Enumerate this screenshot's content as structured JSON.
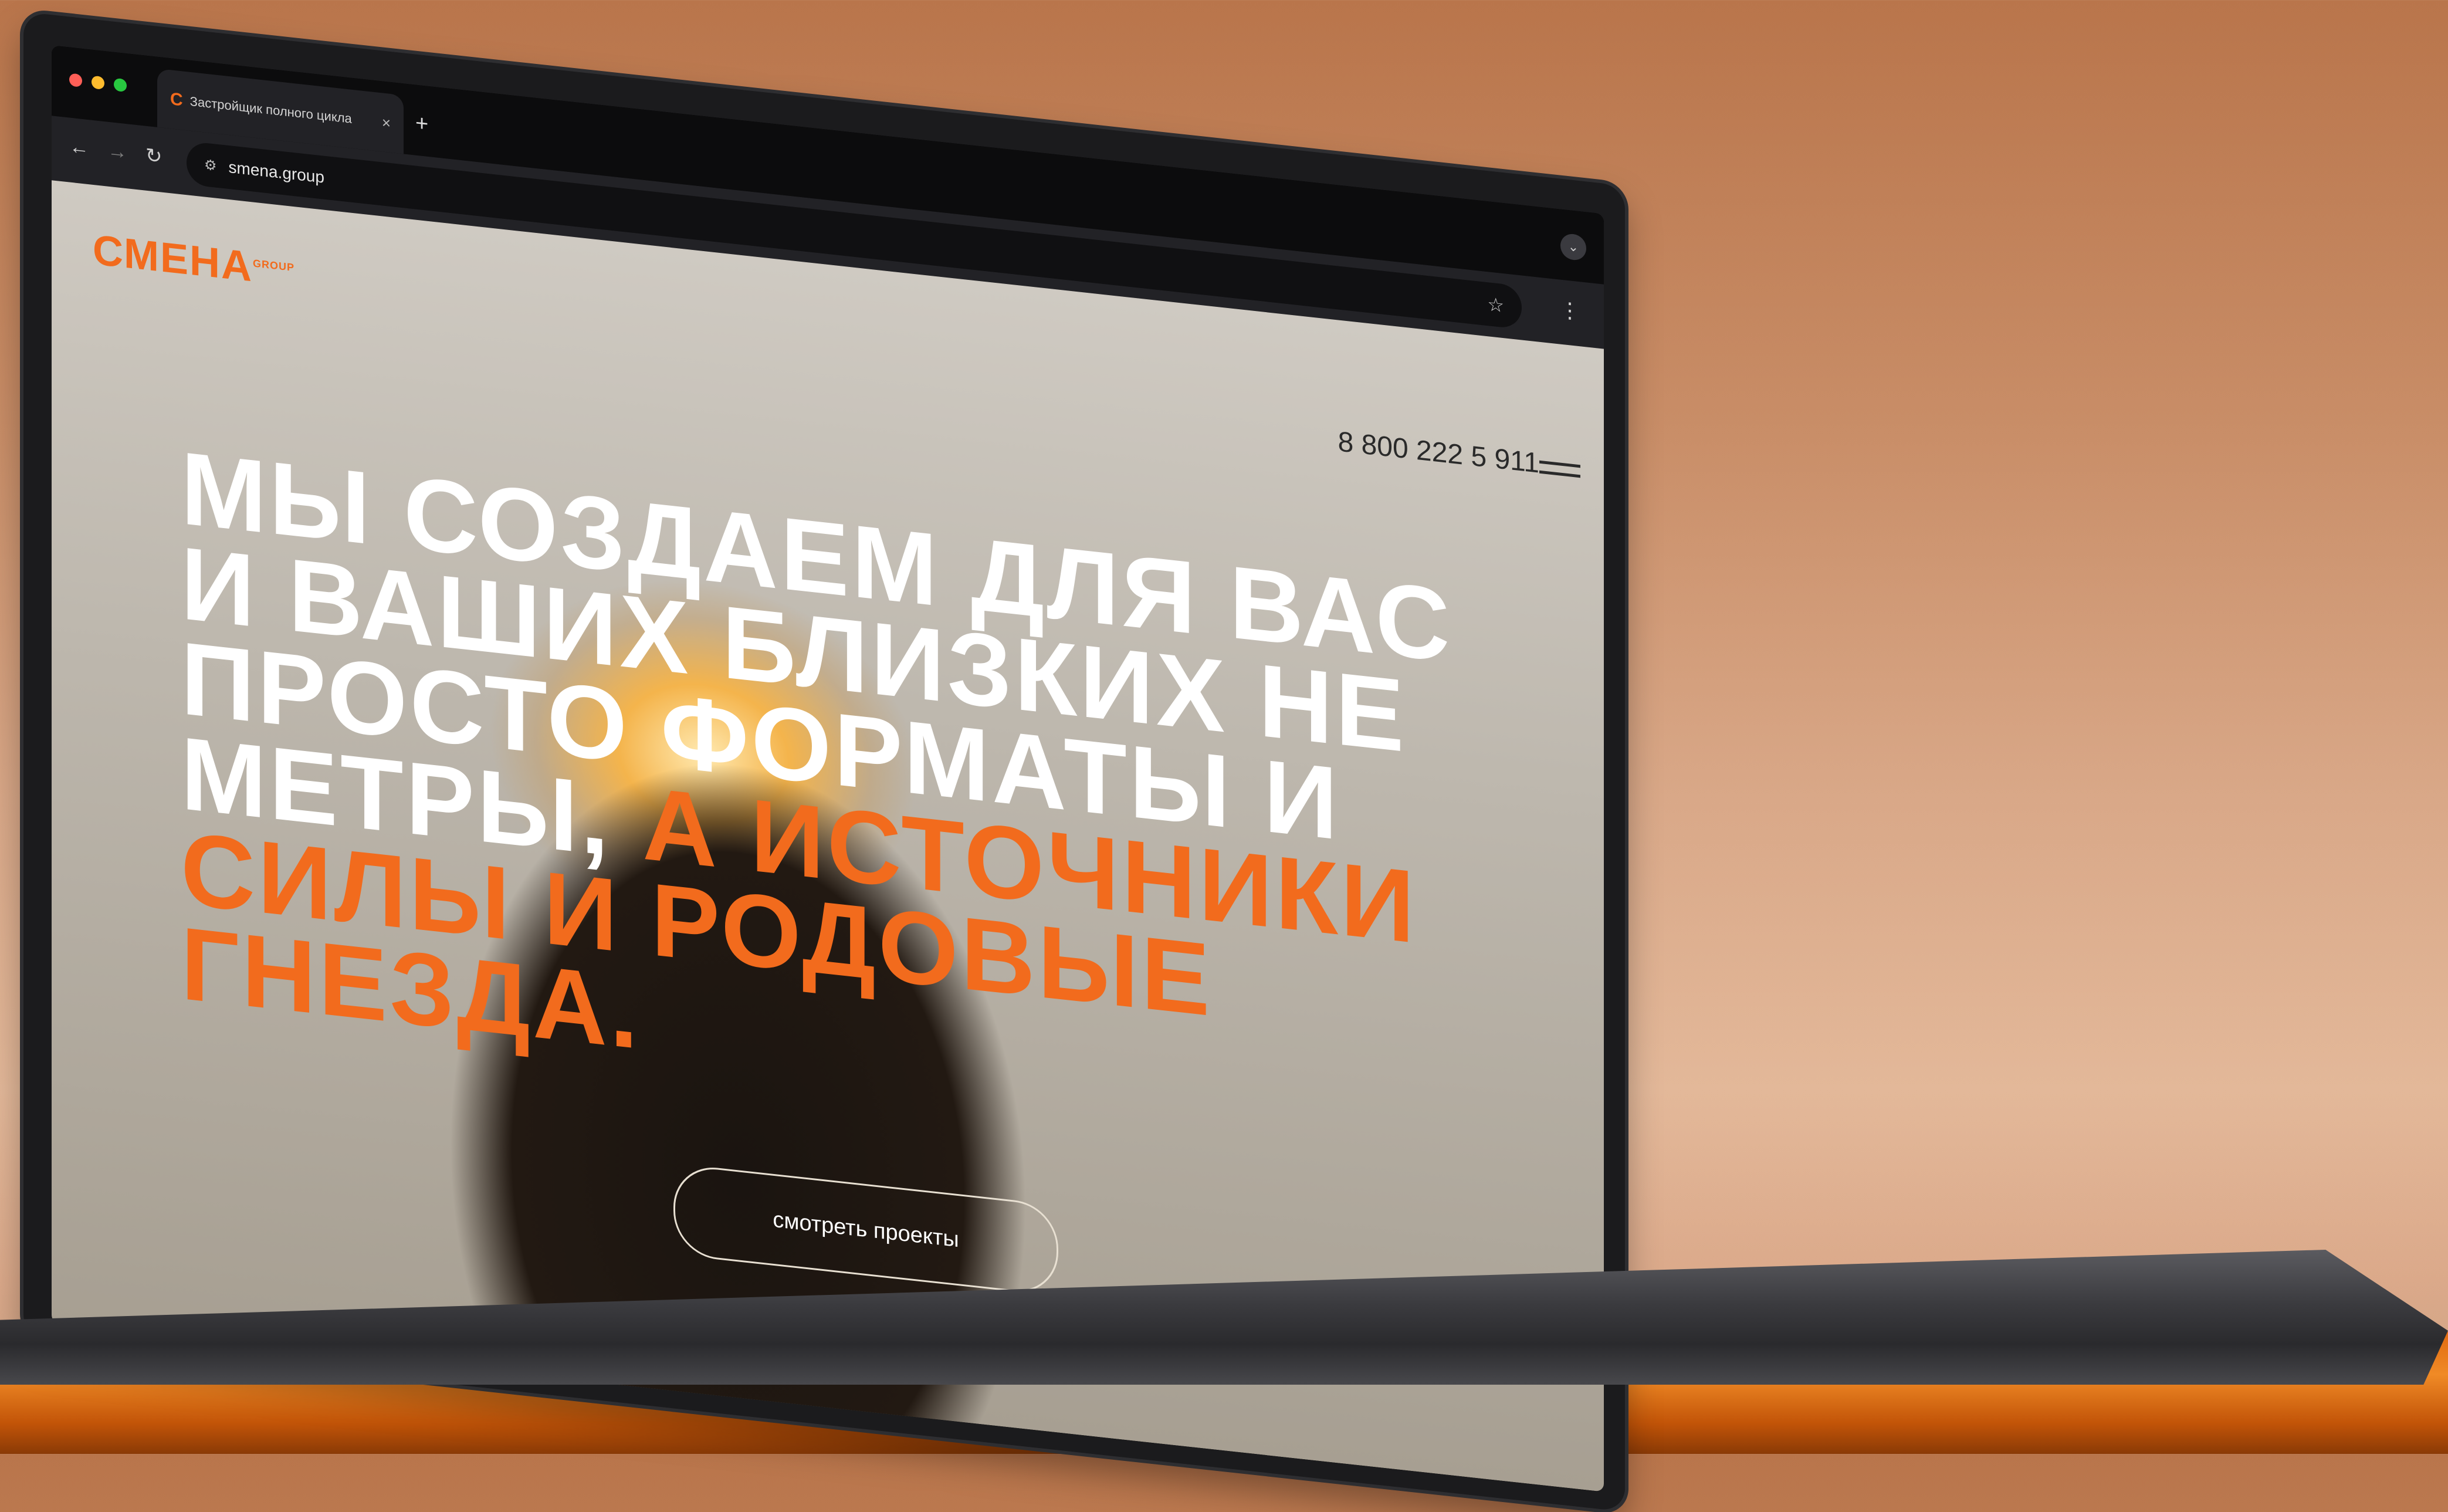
{
  "browser": {
    "tab_title": "Застройщик полного цикла",
    "tab_close": "×",
    "new_tab": "+",
    "url": "smena.group",
    "nav_back": "←",
    "nav_forward": "→",
    "nav_reload": "↻",
    "bookmark_icon": "star-icon",
    "menu_icon": "kebab-icon"
  },
  "site": {
    "logo": "СМЕНА",
    "logo_sub": "GROUP",
    "phone": "8 800 222 5 911",
    "headline_white": "Мы создаем для вас и ваших близких не просто форматы и метры,",
    "headline_accent": "а источники силы и родовые гнезда.",
    "cta": "смотреть проекты",
    "accent_color": "#f26b1d"
  }
}
